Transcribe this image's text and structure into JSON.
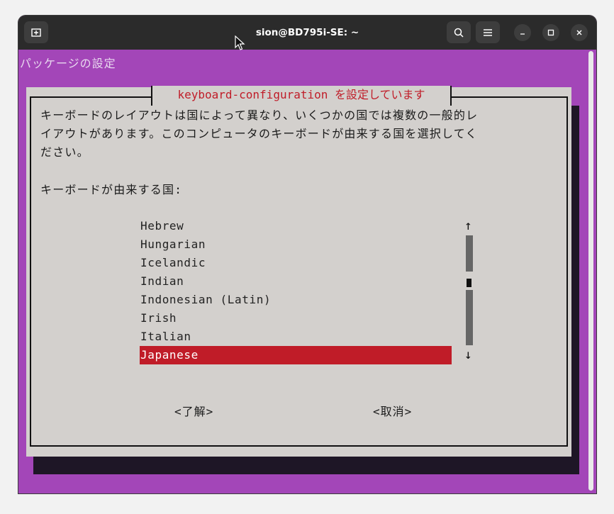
{
  "window": {
    "title": "sion@BD795i-SE: ~"
  },
  "terminal": {
    "package_title": "パッケージの設定",
    "dialog": {
      "title": "keyboard-configuration を設定しています",
      "description_lines": [
        "キーボードのレイアウトは国によって異なり、いくつかの国では複数の一般的レ",
        "イアウトがあります。このコンピュータのキーボードが由来する国を選択してく",
        "ださい。"
      ],
      "prompt": "キーボードが由来する国:",
      "items": [
        "Hebrew",
        "Hungarian",
        "Icelandic",
        "Indian",
        "Indonesian (Latin)",
        "Irish",
        "Italian",
        "Japanese"
      ],
      "selected_index": 7,
      "scroll_up_arrow": "↑",
      "scroll_down_arrow": "↓",
      "ok_label": "<了解>",
      "cancel_label": "<取消>"
    }
  },
  "colors": {
    "accent": "#c01c28",
    "terminal_bg": "#a346b8",
    "dialog_bg": "#d3d0cd"
  }
}
